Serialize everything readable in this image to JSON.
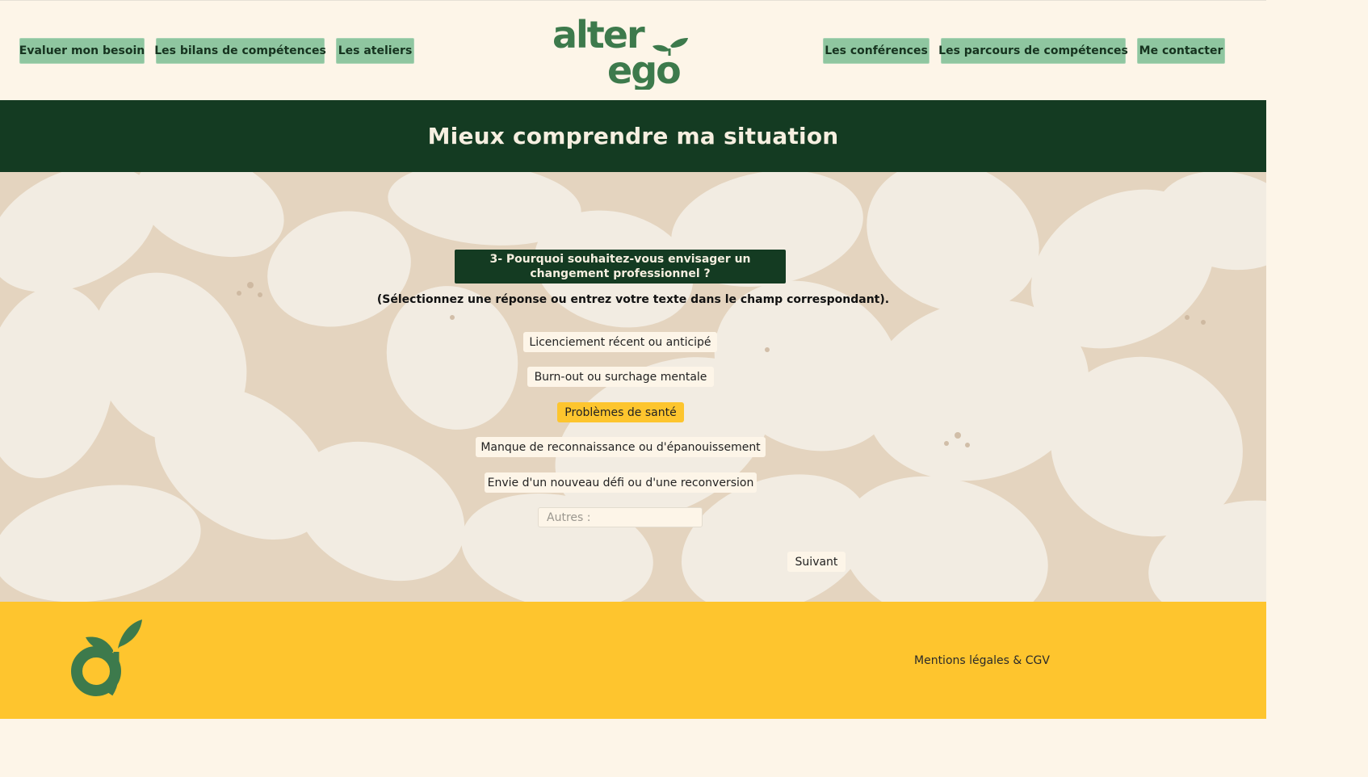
{
  "nav": {
    "left": [
      "Evaluer mon besoin",
      "Les bilans de compétences",
      "Les ateliers"
    ],
    "right": [
      "Les conférences",
      "Les parcours de compétences",
      "Me contacter"
    ]
  },
  "logo": {
    "line1": "alter",
    "line2": "ego"
  },
  "page": {
    "title": "Mieux comprendre ma situation"
  },
  "form": {
    "question": "3- Pourquoi souhaitez-vous envisager un changement professionnel ?",
    "instructions": "(Sélectionnez une réponse ou entrez votre texte dans le champ correspondant).",
    "options": [
      {
        "label": "Licenciement récent ou anticipé",
        "selected": false
      },
      {
        "label": "Burn-out ou surchage mentale",
        "selected": false
      },
      {
        "label": "Problèmes de santé",
        "selected": true
      },
      {
        "label": "Manque de reconnaissance ou d'épanouissement",
        "selected": false
      },
      {
        "label": "Envie d'un nouveau défi ou d'une reconversion",
        "selected": false
      }
    ],
    "other_placeholder": "Autres :",
    "other_value": "",
    "next_label": "Suivant"
  },
  "footer": {
    "legal_link": "Mentions légales & CGV"
  },
  "colors": {
    "cream": "#fdf5e8",
    "dark_green": "#143b22",
    "nav_green": "#8fc6a0",
    "logo_green": "#3d7a4c",
    "yellow": "#fec52e"
  }
}
